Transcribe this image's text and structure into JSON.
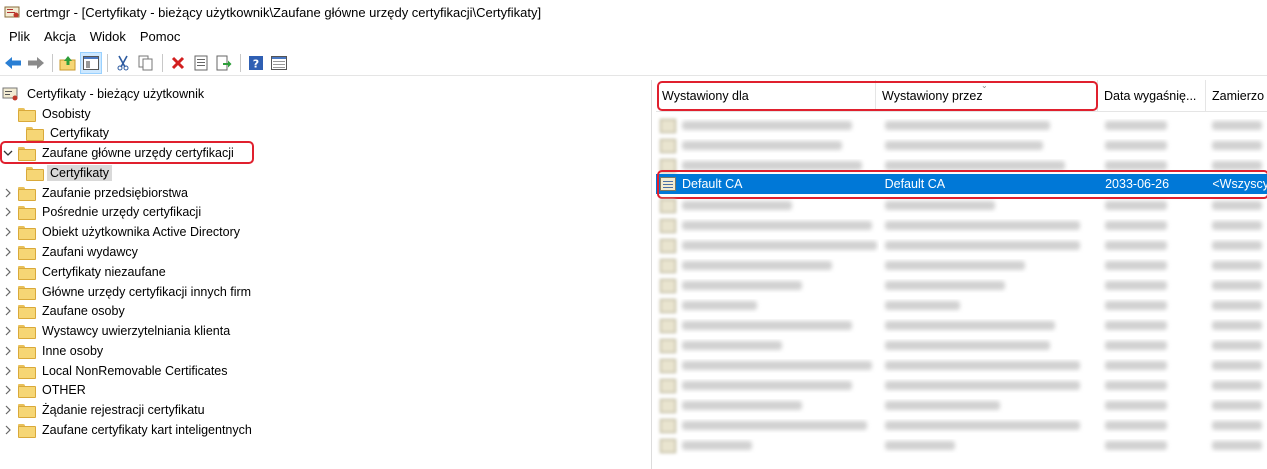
{
  "window": {
    "title": "certmgr - [Certyfikaty - bieżący użytkownik\\Zaufane główne urzędy certyfikacji\\Certyfikaty]",
    "app_icon": "certificate-manager-icon"
  },
  "menu": [
    "Plik",
    "Akcja",
    "Widok",
    "Pomoc"
  ],
  "toolbar": {
    "buttons": [
      "back-icon",
      "forward-icon",
      "up-folder-icon",
      "show-hide-tree-icon",
      "cut-icon",
      "copy-icon",
      "delete-icon",
      "properties-icon",
      "export-icon",
      "help-icon",
      "console-view-icon"
    ]
  },
  "tree": {
    "root": "Certyfikaty - bieżący użytkownik",
    "items": [
      {
        "label": "Osobisty",
        "level": 1,
        "expanded": true
      },
      {
        "label": "Certyfikaty",
        "level": 2
      },
      {
        "label": "Zaufane główne urzędy certyfikacji",
        "level": 1,
        "expanded": true
      },
      {
        "label": "Certyfikaty",
        "level": 2,
        "selected": true
      },
      {
        "label": "Zaufanie przedsiębiorstwa",
        "level": 1
      },
      {
        "label": "Pośrednie urzędy certyfikacji",
        "level": 1
      },
      {
        "label": "Obiekt użytkownika Active Directory",
        "level": 1
      },
      {
        "label": "Zaufani wydawcy",
        "level": 1
      },
      {
        "label": "Certyfikaty niezaufane",
        "level": 1
      },
      {
        "label": "Główne urzędy certyfikacji innych firm",
        "level": 1
      },
      {
        "label": "Zaufane osoby",
        "level": 1
      },
      {
        "label": "Wystawcy uwierzytelniania klienta",
        "level": 1
      },
      {
        "label": "Inne osoby",
        "level": 1
      },
      {
        "label": "Local NonRemovable Certificates",
        "level": 1
      },
      {
        "label": "OTHER",
        "level": 1
      },
      {
        "label": "Żądanie rejestracji certyfikatu",
        "level": 1
      },
      {
        "label": "Zaufane certyfikaty kart inteligentnych",
        "level": 1
      }
    ]
  },
  "list": {
    "columns": [
      "Wystawiony dla",
      "Wystawiony przez",
      "Data wygaśnię...",
      "Zamierzo"
    ],
    "selected_row": {
      "issued_to": "Default CA",
      "issued_by": "Default CA",
      "expires": "2033-06-26",
      "purpose": "<Wszyscy"
    }
  },
  "colors": {
    "selection": "#0078d7",
    "highlight": "#e0202e",
    "folder": "#f6d675"
  }
}
